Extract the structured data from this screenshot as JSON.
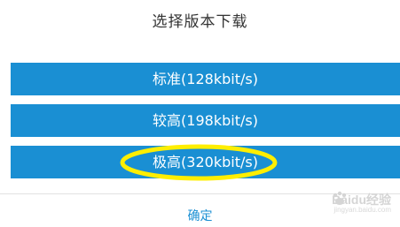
{
  "dialog": {
    "title": "选择版本下载",
    "options": [
      {
        "label": "标准(128kbit/s)"
      },
      {
        "label": "较高(198kbit/s)"
      },
      {
        "label": "极高(320kbit/s)"
      }
    ],
    "confirm_label": "确定"
  },
  "colors": {
    "button_bg": "#1a8fd3",
    "confirm_text": "#1a8fd3",
    "highlight_ring": "#ffee00"
  },
  "watermark": {
    "brand": "Baidu经验",
    "sub": "jingyan.baidu.com"
  }
}
